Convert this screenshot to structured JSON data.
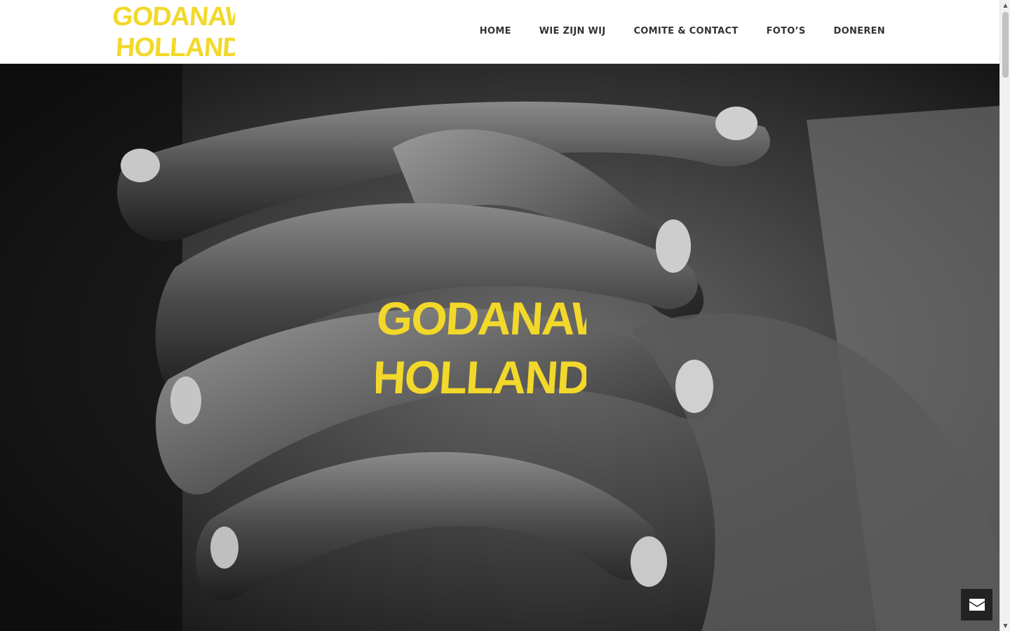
{
  "brand": {
    "name_line1": "GODANAW",
    "name_line2": "HOLLAND",
    "logo_color": "#f2d82a"
  },
  "nav": {
    "items": [
      {
        "label": "HOME"
      },
      {
        "label": "WIE ZIJN WIJ"
      },
      {
        "label": "COMITE & CONTACT"
      },
      {
        "label": "FOTO’S"
      },
      {
        "label": "DONEREN"
      }
    ]
  },
  "hero": {
    "title_line1": "GODANAW",
    "title_line2": "HOLLAND",
    "image_subject": "black-and-white photo of clasped hands"
  },
  "contact_button": {
    "icon": "envelope-icon"
  },
  "colors": {
    "accent_yellow": "#f2d82a",
    "nav_text": "#333333",
    "contact_button_bg": "#222222"
  }
}
